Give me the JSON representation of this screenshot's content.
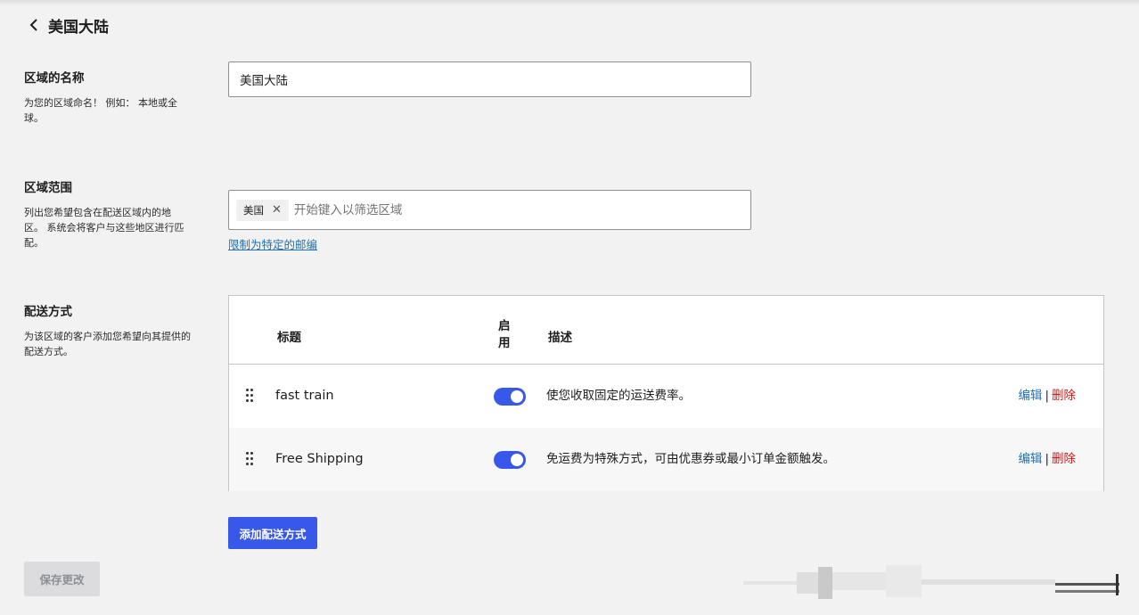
{
  "header": {
    "title": "美国大陆"
  },
  "zone_name": {
    "label": "区域的名称",
    "description": "为您的区域命名！ 例如： 本地或全球。",
    "value": "美国大陆"
  },
  "zone_regions": {
    "label": "区域范围",
    "description": "列出您希望包含在配送区域内的地区。 系统会将客户与这些地区进行匹配。",
    "chips": [
      "美国"
    ],
    "placeholder": "开始键入以筛选区域",
    "postcode_link": "限制为特定的邮编"
  },
  "shipping_methods": {
    "label": "配送方式",
    "description": "为该区域的客户添加您希望向其提供的配送方式。",
    "columns": {
      "title": "标题",
      "enabled": "启用",
      "description": "描述"
    },
    "rows": [
      {
        "title": "fast train",
        "enabled": true,
        "description": "使您收取固定的运送费率。",
        "edit": "编辑",
        "separator": "|",
        "delete": "删除"
      },
      {
        "title": "Free Shipping",
        "enabled": true,
        "description": "免运费为特殊方式，可由优惠券或最小订单金额触发。",
        "edit": "编辑",
        "separator": "|",
        "delete": "删除"
      }
    ],
    "add_button": "添加配送方式"
  },
  "footer": {
    "save_button": "保存更改"
  },
  "colors": {
    "accent": "#3858e9",
    "link": "#2271b1",
    "danger": "#cc1818"
  }
}
